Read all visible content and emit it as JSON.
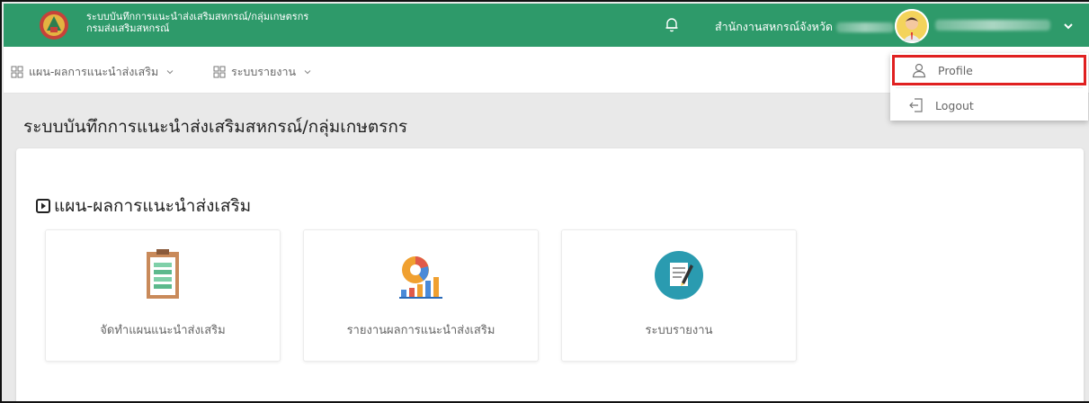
{
  "header": {
    "title_line1": "ระบบบันทึกการแนะนำส่งเสริมสหกรณ์/กลุ่มเกษตรกร",
    "title_line2": "กรมส่งเสริมสหกรณ์",
    "office_label": "สำนักงานสหกรณ์จังหวัด",
    "colors": {
      "brand": "#2e9a6a",
      "highlight": "#e02020"
    }
  },
  "menubar": {
    "items": [
      {
        "label": "แผน-ผลการแนะนำส่งเสริม",
        "icon": "grid-icon"
      },
      {
        "label": "ระบบรายงาน",
        "icon": "grid-icon"
      }
    ]
  },
  "user_menu": {
    "profile_label": "Profile",
    "logout_label": "Logout"
  },
  "page": {
    "title": "ระบบบันทึกการแนะนำส่งเสริมสหกรณ์/กลุ่มเกษตรกร",
    "section_title": "แผน-ผลการแนะนำส่งเสริม",
    "cards": [
      {
        "label": "จัดทำแผนแนะนำส่งเสริม",
        "icon": "clipboard-icon"
      },
      {
        "label": "รายงานผลการแนะนำส่งเสริม",
        "icon": "chart-report-icon"
      },
      {
        "label": "ระบบรายงาน",
        "icon": "edit-document-icon"
      }
    ]
  }
}
